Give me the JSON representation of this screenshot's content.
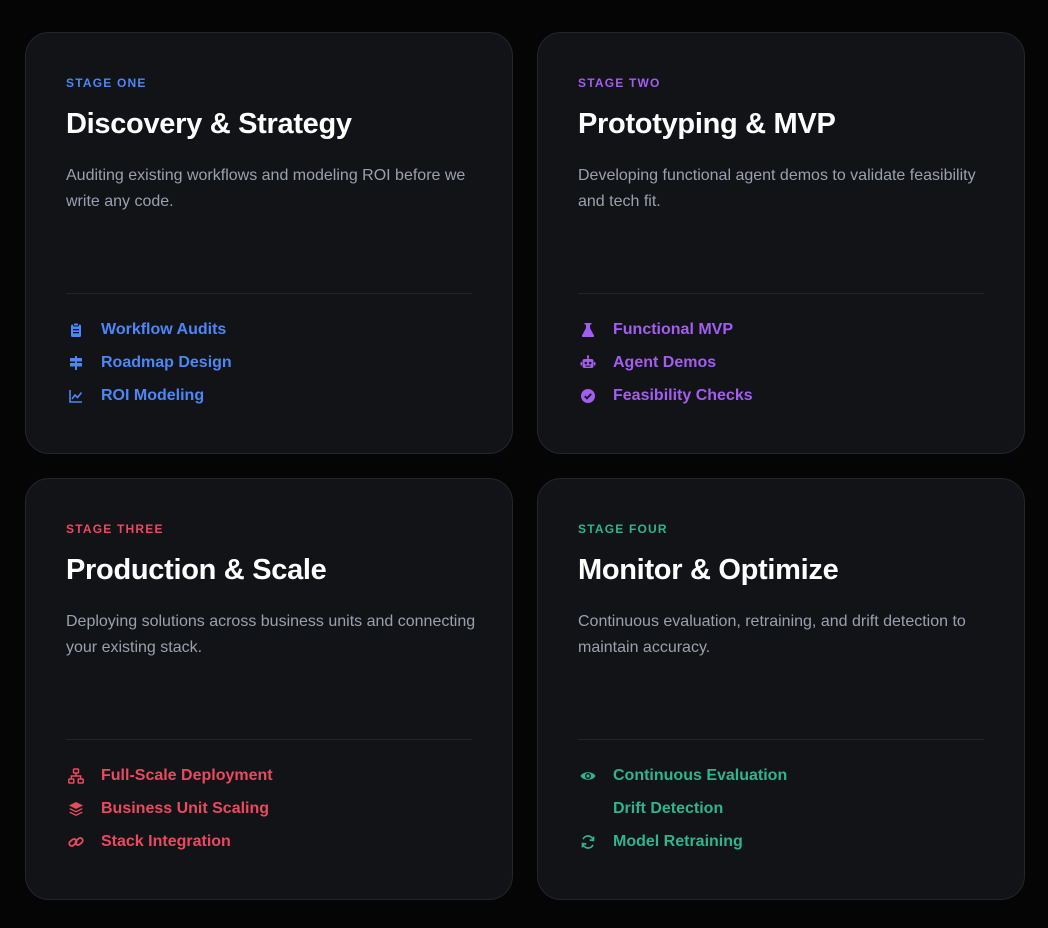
{
  "colors": {
    "blue": "#4d86f7",
    "purple": "#a35df0",
    "red": "#ea4a60",
    "green": "#2fb58a"
  },
  "stages": [
    {
      "label": "STAGE ONE",
      "title": "Discovery & Strategy",
      "description": "Auditing existing workflows and modeling ROI before we write any code.",
      "features": [
        {
          "icon": "clipboard-icon",
          "label": "Workflow Audits"
        },
        {
          "icon": "signpost-icon",
          "label": "Roadmap Design"
        },
        {
          "icon": "line-chart-icon",
          "label": "ROI Modeling"
        }
      ]
    },
    {
      "label": "STAGE TWO",
      "title": "Prototyping & MVP",
      "description": "Developing functional agent demos to validate feasibility and tech fit.",
      "features": [
        {
          "icon": "flask-icon",
          "label": "Functional MVP"
        },
        {
          "icon": "robot-icon",
          "label": "Agent Demos"
        },
        {
          "icon": "check-circle-icon",
          "label": "Feasibility Checks"
        }
      ]
    },
    {
      "label": "STAGE THREE",
      "title": "Production & Scale",
      "description": "Deploying solutions across business units and connecting your existing stack.",
      "features": [
        {
          "icon": "sitemap-icon",
          "label": "Full-Scale Deployment"
        },
        {
          "icon": "layers-icon",
          "label": "Business Unit Scaling"
        },
        {
          "icon": "link-icon",
          "label": "Stack Integration"
        }
      ]
    },
    {
      "label": "STAGE FOUR",
      "title": "Monitor & Optimize",
      "description": "Continuous evaluation, retraining, and drift detection to maintain accuracy.",
      "features": [
        {
          "icon": "eye-icon",
          "label": "Continuous Evaluation"
        },
        {
          "icon": "",
          "label": "Drift Detection"
        },
        {
          "icon": "refresh-icon",
          "label": "Model Retraining"
        }
      ]
    }
  ]
}
